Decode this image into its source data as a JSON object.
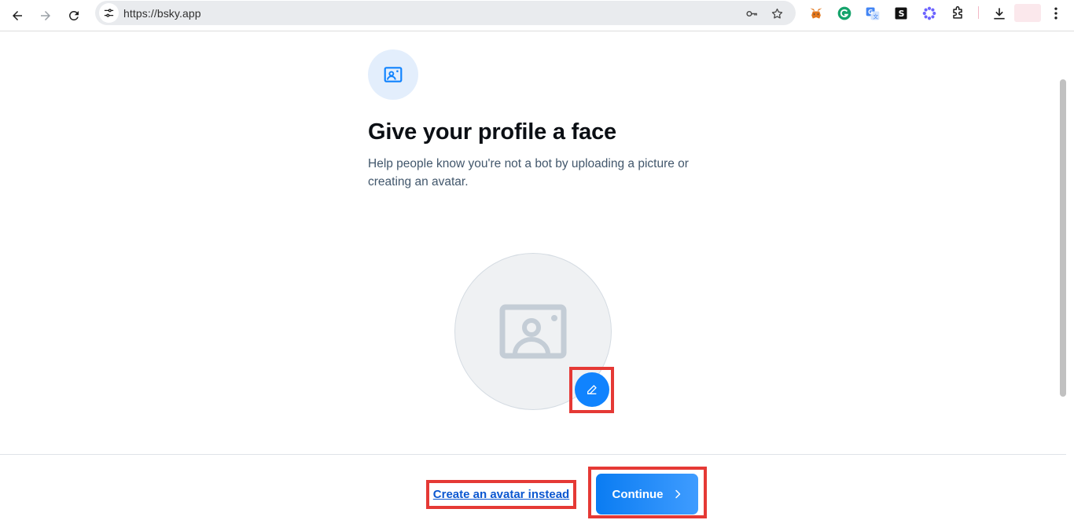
{
  "browser": {
    "url": "https://bsky.app"
  },
  "onboarding": {
    "title": "Give your profile a face",
    "subtitle": "Help people know you're not a bot by uploading a picture or creating an avatar."
  },
  "footer": {
    "create_avatar_label": "Create an avatar instead",
    "continue_label": "Continue"
  },
  "colors": {
    "accent": "#1083fe",
    "highlight": "#e53935"
  }
}
